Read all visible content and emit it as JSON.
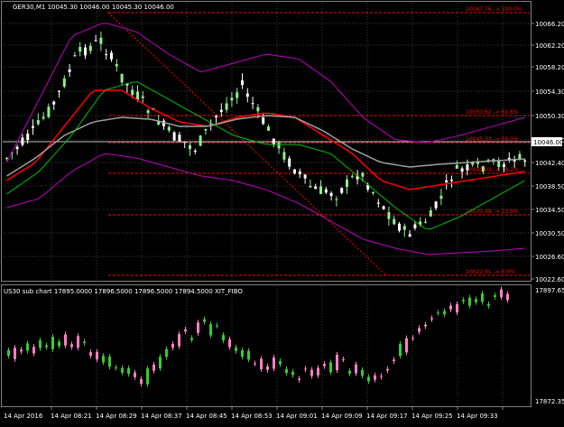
{
  "main_chart": {
    "header": {
      "symbol_tf": "GER30,M1",
      "ohlc": "10045.30 10046.00 10045.30 10046.00"
    },
    "price_axis": {
      "labels": [
        "10066.20",
        "10062.20",
        "10058.20",
        "10054.30",
        "10050.30",
        "10046.30",
        "10042.40",
        "10038.50",
        "10034.50",
        "10030.50",
        "10026.60",
        "10022.60"
      ],
      "current_price": "10046.00"
    },
    "fibo_levels": [
      {
        "label": "10067.76 -> 100.0%"
      },
      {
        "label": "10050.62 -> 61.8%"
      },
      {
        "label": "10045.33 -> 50.0%"
      },
      {
        "label": "10040.03 -> 38.2%"
      },
      {
        "label": "10033.49 -> 23.6%"
      },
      {
        "label": "10022.91 -> 0.0%"
      }
    ]
  },
  "sub_chart": {
    "header": "US30 sub chart  17895.0000  17896.5000  17896.5000  17894.5000  XIT_FIBO",
    "price_axis": {
      "top": "17897.65",
      "bottom": "17872.35"
    }
  },
  "time_axis": [
    "14 Apr 2016",
    "14 Apr 08:21",
    "14 Apr 08:29",
    "14 Apr 08:37",
    "14 Apr 08:45",
    "14 Apr 08:53",
    "14 Apr 09:01",
    "14 Apr 09:09",
    "14 Apr 09:17",
    "14 Apr 09:25",
    "14 Apr 09:33"
  ],
  "colors": {
    "background": "#000000",
    "grid": "#3a3a3a",
    "bull_candle": "#90ee90",
    "bear_candle": "#ffffff",
    "sub_bull": "#32cd32",
    "sub_bear": "#ff80c0",
    "bollinger": "#c000c0",
    "ma_fast": "#ff0000",
    "ma_slow": "#a0a0a0",
    "fibo": "#ff0000"
  }
}
